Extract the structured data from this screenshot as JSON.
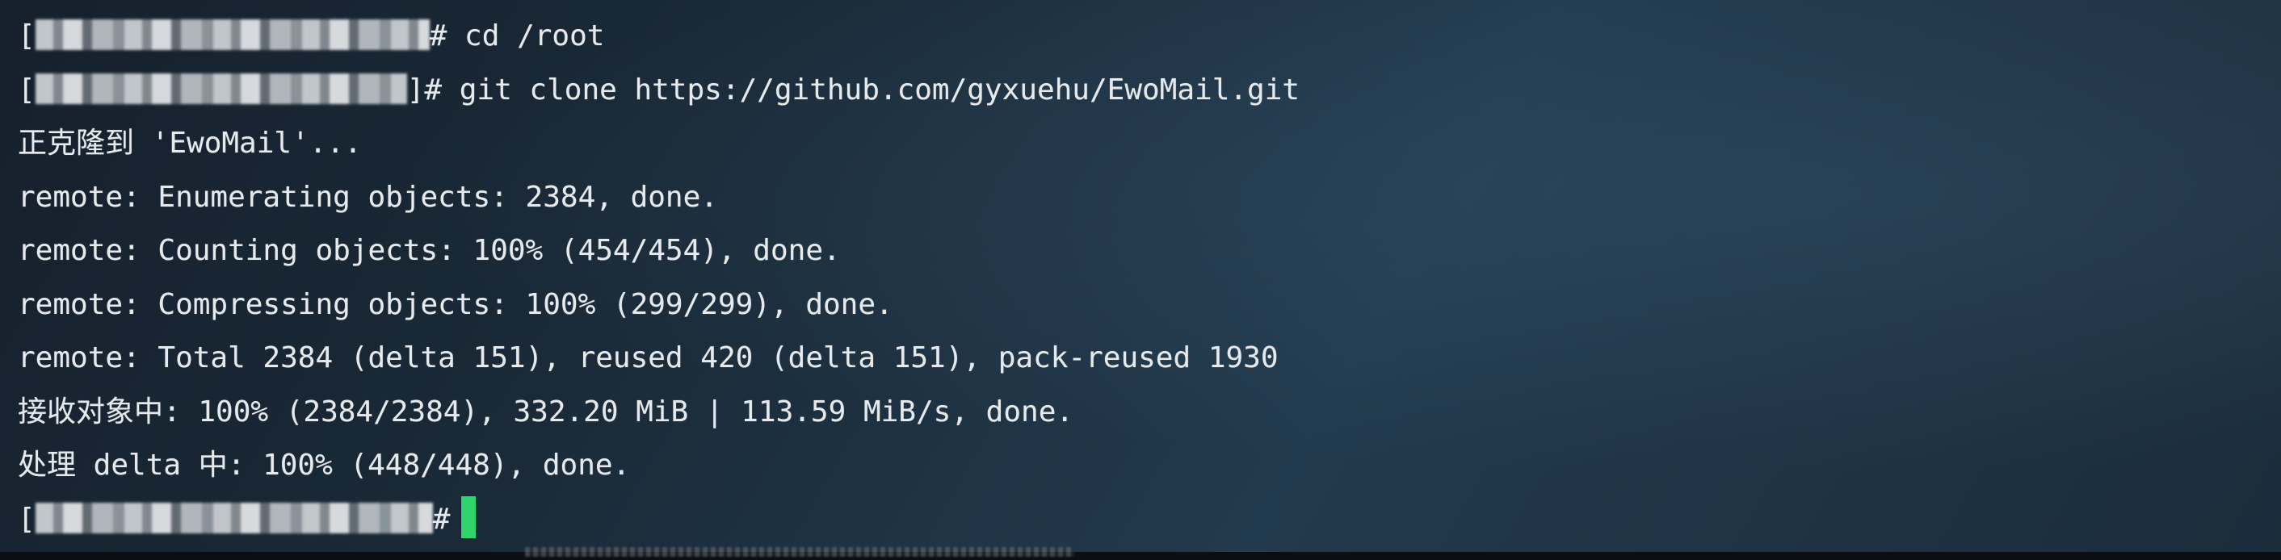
{
  "terminal": {
    "prompt_open": "[",
    "prompt_close_hash": "#",
    "prompt_close_bracket_hash": "]#",
    "commands": {
      "cd": " cd /root",
      "clone": " git clone https://github.com/gyxuehu/EwoMail.git"
    },
    "output": [
      "正克隆到 'EwoMail'...",
      "remote: Enumerating objects: 2384, done.",
      "remote: Counting objects: 100% (454/454), done.",
      "remote: Compressing objects: 100% (299/299), done.",
      "remote: Total 2384 (delta 151), reused 420 (delta 151), pack-reused 1930",
      "接收对象中: 100% (2384/2384), 332.20 MiB | 113.59 MiB/s, done.",
      "处理 delta 中: 100% (448/448), done."
    ]
  }
}
